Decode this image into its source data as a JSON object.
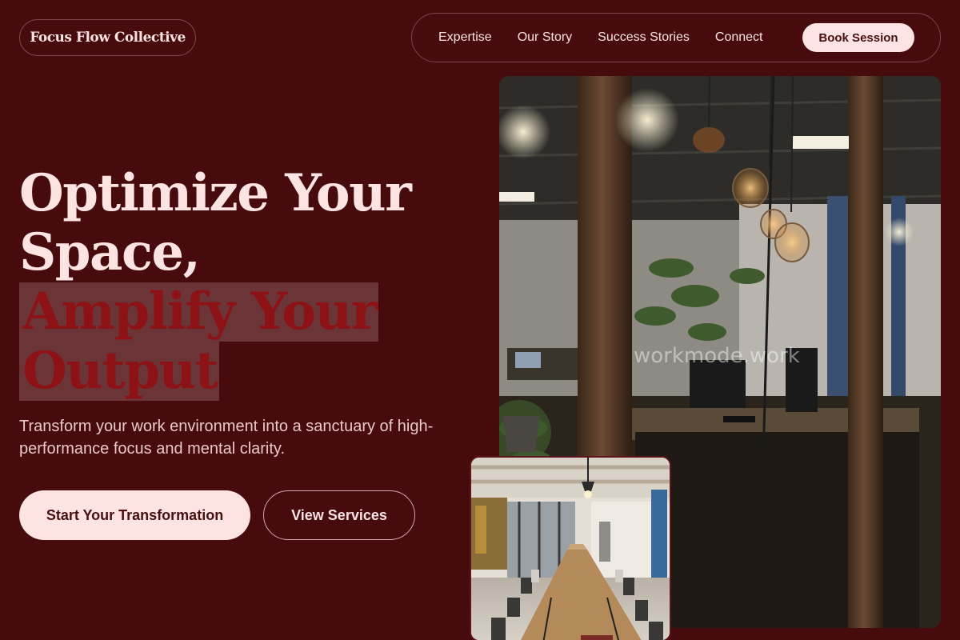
{
  "brand": {
    "name": "Focus Flow Collective"
  },
  "nav": {
    "links": [
      "Expertise",
      "Our Story",
      "Success Stories",
      "Connect"
    ],
    "cta": "Book Session"
  },
  "hero": {
    "title_line1": "Optimize Your",
    "title_line2": "Space,",
    "title_highlight1": "Amplify Your",
    "title_highlight2": "Output",
    "description": "Transform your work environment into a sanctuary of high-performance focus and mental clarity.",
    "primary_cta": "Start Your Transformation",
    "secondary_cta": "View Services"
  },
  "images": {
    "main_watermark": "workmode.work",
    "main_alt": "dim industrial office with pendant lights and plants",
    "small_alt": "bright open workspace with long shared tables"
  },
  "colors": {
    "background": "#470b0d",
    "accent_light": "#fde3e2",
    "highlight_text": "#8d1216"
  }
}
